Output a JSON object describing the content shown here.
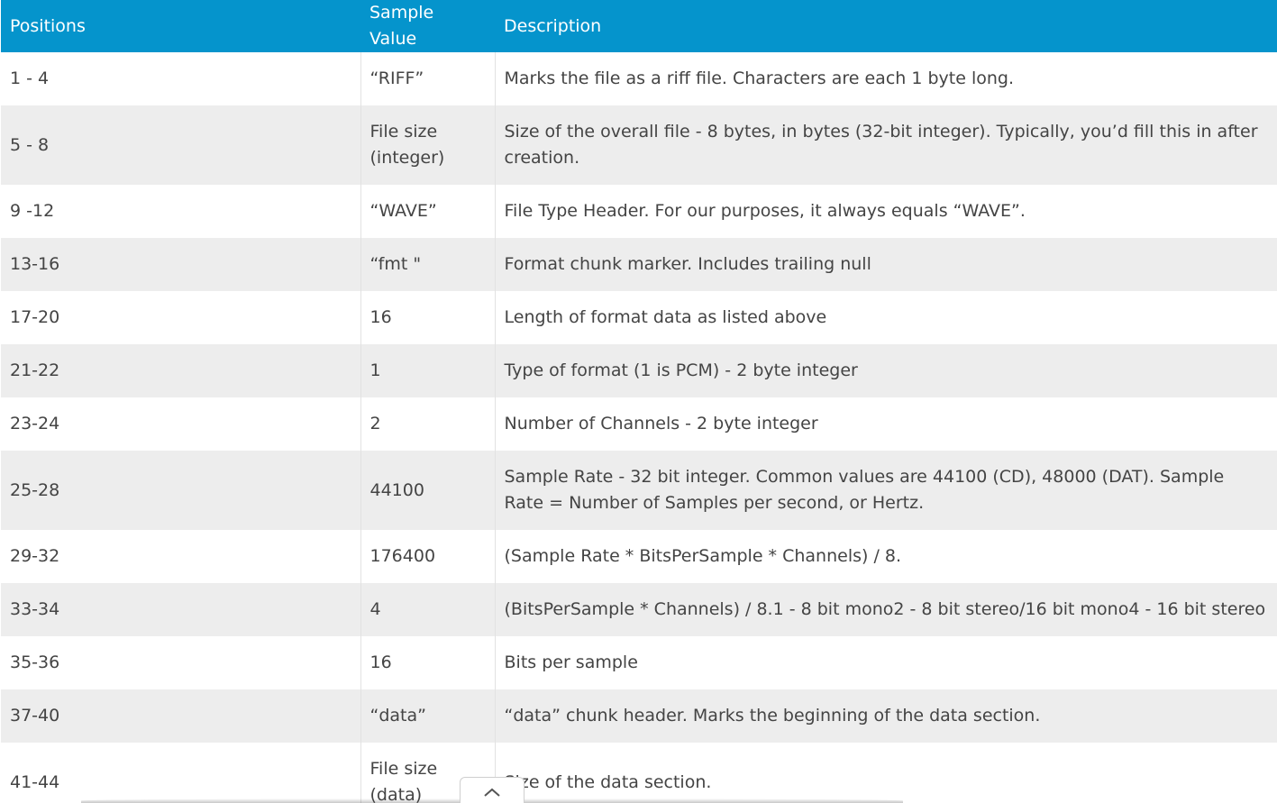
{
  "table": {
    "headers": [
      "Positions",
      "Sample Value",
      "Description"
    ],
    "rows": [
      {
        "pos": "1 - 4",
        "value": "“RIFF”",
        "desc": "Marks the file as a riff file. Characters are each 1 byte long."
      },
      {
        "pos": "5 - 8",
        "value": "File size (integer)",
        "desc": "Size of the overall file - 8 bytes, in bytes (32-bit integer). Typically, you’d fill this in after creation."
      },
      {
        "pos": "9 -12",
        "value": "“WAVE”",
        "desc": "File Type Header. For our purposes, it always equals “WAVE”."
      },
      {
        "pos": "13-16",
        "value": "“fmt \"",
        "desc": "Format chunk marker. Includes trailing null"
      },
      {
        "pos": "17-20",
        "value": "16",
        "desc": "Length of format data as listed above"
      },
      {
        "pos": "21-22",
        "value": "1",
        "desc": "Type of format (1 is PCM) - 2 byte integer"
      },
      {
        "pos": "23-24",
        "value": "2",
        "desc": "Number of Channels - 2 byte integer"
      },
      {
        "pos": "25-28",
        "value": "44100",
        "desc": "Sample Rate - 32 bit integer. Common values are 44100 (CD), 48000 (DAT). Sample Rate = Number of Samples per second, or Hertz."
      },
      {
        "pos": "29-32",
        "value": "176400",
        "desc": "(Sample Rate * BitsPerSample * Channels) / 8."
      },
      {
        "pos": "33-34",
        "value": "4",
        "desc": "(BitsPerSample * Channels) / 8.1 - 8 bit mono2 - 8 bit stereo/16 bit mono4 - 16 bit stereo"
      },
      {
        "pos": "35-36",
        "value": "16",
        "desc": "Bits per sample"
      },
      {
        "pos": "37-40",
        "value": "“data”",
        "desc": "“data” chunk header. Marks the beginning of the data section."
      },
      {
        "pos": "41-44",
        "value": "File size (data)",
        "desc": "Size of the data section."
      }
    ]
  },
  "scroll_top_button": {
    "icon": "chevron-up-icon"
  },
  "colors": {
    "header_bg": "#0594cc",
    "header_text": "#ffffff",
    "stripe": "#ededed",
    "body_text": "#444444"
  }
}
